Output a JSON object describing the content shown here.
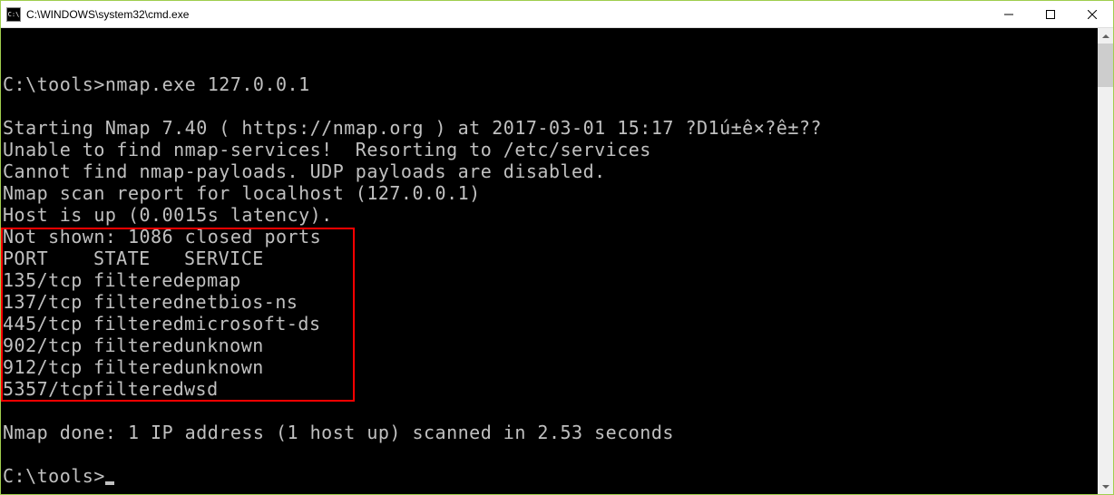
{
  "window": {
    "title": "C:\\WINDOWS\\system32\\cmd.exe",
    "icon_label": "C:\\"
  },
  "prompt1_path": "C:\\tools>",
  "prompt1_cmd": "nmap.exe 127.0.0.1",
  "lines": {
    "start": "Starting Nmap 7.40 ( https://nmap.org ) at 2017-03-01 15:17 ?D1ú±ê×?ê±??",
    "unable": "Unable to find nmap-services!  Resorting to /etc/services",
    "cannot": "Cannot find nmap-payloads. UDP payloads are disabled.",
    "report": "Nmap scan report for localhost (127.0.0.1)",
    "host": "Host is up (0.0015s latency).",
    "notshown": "Not shown: 1086 closed ports",
    "done": "Nmap done: 1 IP address (1 host up) scanned in 2.53 seconds"
  },
  "table": {
    "header": {
      "port": "PORT",
      "state": "STATE",
      "service": "SERVICE"
    },
    "rows": [
      {
        "port": "135/tcp",
        "state": "filtered",
        "service": "epmap"
      },
      {
        "port": "137/tcp",
        "state": "filtered",
        "service": "netbios-ns"
      },
      {
        "port": "445/tcp",
        "state": "filtered",
        "service": "microsoft-ds"
      },
      {
        "port": "902/tcp",
        "state": "filtered",
        "service": "unknown"
      },
      {
        "port": "912/tcp",
        "state": "filtered",
        "service": "unknown"
      },
      {
        "port": "5357/tcp",
        "state": "filtered",
        "service": "wsd"
      }
    ]
  },
  "prompt2_path": "C:\\tools>"
}
